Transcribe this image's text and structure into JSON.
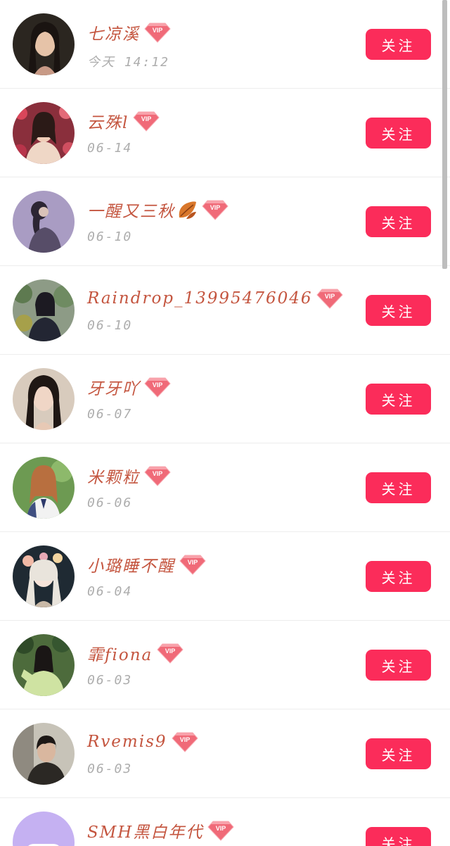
{
  "follow_label": "关注",
  "colors": {
    "follow_button": "#fb2c5a",
    "name_text": "#c4553f",
    "date_text": "#adadad",
    "vip_badge": "#f06a78"
  },
  "users": [
    {
      "name": "七凉溪",
      "date": "今天 14:12",
      "vip": true,
      "vip_label": "VIP",
      "avatar": "user-photo-woman-dark-hair"
    },
    {
      "name": "云殊l",
      "date": "06-14",
      "vip": true,
      "vip_label": "VIP",
      "avatar": "user-photo-woman-flowers"
    },
    {
      "name": "一醒又三秋",
      "date": "06-10",
      "vip": true,
      "vip_label": "VIP",
      "avatar": "user-photo-woman-purple",
      "emoji": "fallen-leaf-icon"
    },
    {
      "name": "Raindrop_13995476046",
      "date": "06-10",
      "vip": true,
      "vip_label": "VIP",
      "avatar": "user-photo-woman-garden"
    },
    {
      "name": "牙牙吖",
      "date": "06-07",
      "vip": true,
      "vip_label": "VIP",
      "avatar": "user-photo-woman-portrait"
    },
    {
      "name": "米颗粒",
      "date": "06-06",
      "vip": true,
      "vip_label": "VIP",
      "avatar": "user-photo-girl-uniform"
    },
    {
      "name": "小璐睡不醒",
      "date": "06-04",
      "vip": true,
      "vip_label": "VIP",
      "avatar": "user-illustration-anime-girl"
    },
    {
      "name": "霏fiona",
      "date": "06-03",
      "vip": true,
      "vip_label": "VIP",
      "avatar": "user-photo-woman-green-jacket"
    },
    {
      "name": "Rvemis9",
      "date": "06-03",
      "vip": true,
      "vip_label": "VIP",
      "avatar": "user-photo-man-portrait"
    },
    {
      "name": "SMH黑白年代",
      "date": "",
      "vip": true,
      "vip_label": "VIP",
      "avatar": "user-default-purple-robot"
    }
  ]
}
